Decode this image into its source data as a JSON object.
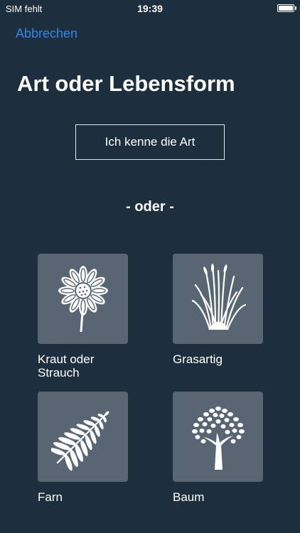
{
  "status_bar": {
    "carrier": "SIM fehlt",
    "time": "19:39",
    "battery_icon": "battery-full-icon"
  },
  "nav": {
    "cancel_label": "Abbrechen"
  },
  "header": {
    "title": "Art oder Lebensform"
  },
  "actions": {
    "know_species_label": "Ich kenne die Art",
    "or_label": "- oder -"
  },
  "categories": [
    {
      "label": "Kraut oder Strauch",
      "icon": "flower-icon"
    },
    {
      "label": "Grasartig",
      "icon": "grass-icon"
    },
    {
      "label": "Farn",
      "icon": "fern-icon"
    },
    {
      "label": "Baum",
      "icon": "tree-icon"
    }
  ],
  "colors": {
    "background": "#1d2f3f",
    "accent": "#2f86e8",
    "tile": "#586674"
  }
}
